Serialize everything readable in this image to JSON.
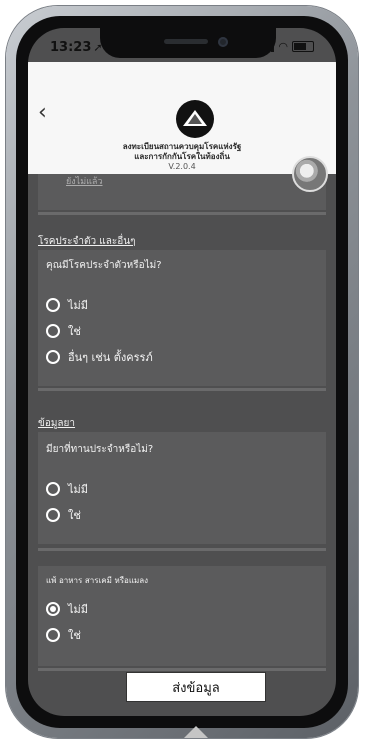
{
  "status_bar": {
    "time": "13:23",
    "location_arrow": "➚"
  },
  "header": {
    "back_icon": "‹",
    "title_line1": "ลงทะเบียนสถานควบคุมโรคแห่งรัฐ",
    "title_line2": "และการกักกันโรคในท้องถิ่น",
    "version": "V.2.0.4"
  },
  "top_link": "ยังไม่แล้ว",
  "sections": {
    "disease": {
      "title": "โรคประจำตัว และอื่นๆ",
      "question": "คุณมีโรคประจำตัวหรือไม่?",
      "options": [
        "ไม่มี",
        "ใช่",
        "อื่นๆ เช่น ตั้งครรภ์"
      ]
    },
    "medicine": {
      "title": "ข้อมูลยา",
      "question": "มียาที่ทานประจำหรือไม่?",
      "options": [
        "ไม่มี",
        "ใช่"
      ]
    },
    "allergy": {
      "title": "แพ้ อาหาร สารเคมี หรือแมลง",
      "options": [
        "ไม่มี",
        "ใช่"
      ],
      "selected": "ไม่มี"
    }
  },
  "submit_label": "ส่งข้อมูล"
}
